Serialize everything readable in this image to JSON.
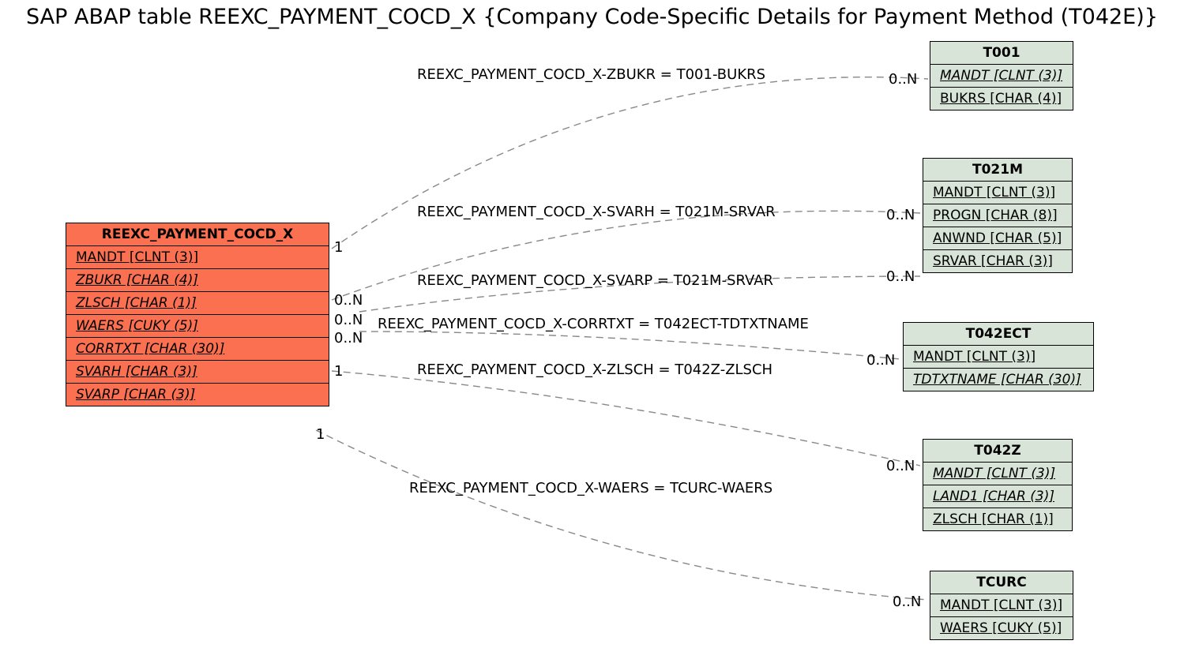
{
  "title": "SAP ABAP table REEXC_PAYMENT_COCD_X {Company Code-Specific Details for Payment Method (T042E)}",
  "main": {
    "name": "REEXC_PAYMENT_COCD_X",
    "fields": [
      "MANDT [CLNT (3)]",
      "ZBUKR [CHAR (4)]",
      "ZLSCH [CHAR (1)]",
      "WAERS [CUKY (5)]",
      "CORRTXT [CHAR (30)]",
      "SVARH [CHAR (3)]",
      "SVARP [CHAR (3)]"
    ],
    "italic": [
      false,
      true,
      true,
      true,
      true,
      true,
      true
    ]
  },
  "targets": {
    "t001": {
      "name": "T001",
      "fields": [
        "MANDT [CLNT (3)]",
        "BUKRS [CHAR (4)]"
      ],
      "italic": [
        true,
        false
      ]
    },
    "t021m": {
      "name": "T021M",
      "fields": [
        "MANDT [CLNT (3)]",
        "PROGN [CHAR (8)]",
        "ANWND [CHAR (5)]",
        "SRVAR [CHAR (3)]"
      ],
      "italic": [
        false,
        false,
        false,
        false
      ]
    },
    "t042ect": {
      "name": "T042ECT",
      "fields": [
        "MANDT [CLNT (3)]",
        "TDTXTNAME [CHAR (30)]"
      ],
      "italic": [
        false,
        true
      ]
    },
    "t042z": {
      "name": "T042Z",
      "fields": [
        "MANDT [CLNT (3)]",
        "LAND1 [CHAR (3)]",
        "ZLSCH [CHAR (1)]"
      ],
      "italic": [
        true,
        true,
        false
      ]
    },
    "tcurc": {
      "name": "TCURC",
      "fields": [
        "MANDT [CLNT (3)]",
        "WAERS [CUKY (5)]"
      ],
      "italic": [
        false,
        false
      ]
    }
  },
  "rels": {
    "r1": "REEXC_PAYMENT_COCD_X-ZBUKR = T001-BUKRS",
    "r2": "REEXC_PAYMENT_COCD_X-SVARH = T021M-SRVAR",
    "r3": "REEXC_PAYMENT_COCD_X-SVARP = T021M-SRVAR",
    "r4": "REEXC_PAYMENT_COCD_X-CORRTXT = T042ECT-TDTXTNAME",
    "r5": "REEXC_PAYMENT_COCD_X-ZLSCH = T042Z-ZLSCH",
    "r6": "REEXC_PAYMENT_COCD_X-WAERS = TCURC-WAERS"
  },
  "cards": {
    "l1": "1",
    "l2": "0..N",
    "l3": "0..N",
    "l4": "0..N",
    "l5": "1",
    "l6": "1",
    "rt1": "0..N",
    "rt2": "0..N",
    "rt3": "0..N",
    "rt4": "0..N",
    "rt5": "0..N",
    "rt6": "0..N"
  },
  "chart_data": {
    "type": "table",
    "description": "Entity-relationship diagram for SAP ABAP table REEXC_PAYMENT_COCD_X and related tables",
    "source_entity": {
      "name": "REEXC_PAYMENT_COCD_X",
      "color": "orange",
      "fields": [
        {
          "name": "MANDT",
          "type": "CLNT",
          "len": 3,
          "key_italic": false
        },
        {
          "name": "ZBUKR",
          "type": "CHAR",
          "len": 4,
          "key_italic": true
        },
        {
          "name": "ZLSCH",
          "type": "CHAR",
          "len": 1,
          "key_italic": true
        },
        {
          "name": "WAERS",
          "type": "CUKY",
          "len": 5,
          "key_italic": true
        },
        {
          "name": "CORRTXT",
          "type": "CHAR",
          "len": 30,
          "key_italic": true
        },
        {
          "name": "SVARH",
          "type": "CHAR",
          "len": 3,
          "key_italic": true
        },
        {
          "name": "SVARP",
          "type": "CHAR",
          "len": 3,
          "key_italic": true
        }
      ]
    },
    "target_entities": [
      {
        "name": "T001",
        "color": "green",
        "fields": [
          {
            "name": "MANDT",
            "type": "CLNT",
            "len": 3,
            "key_italic": true
          },
          {
            "name": "BUKRS",
            "type": "CHAR",
            "len": 4,
            "key_italic": false
          }
        ]
      },
      {
        "name": "T021M",
        "color": "green",
        "fields": [
          {
            "name": "MANDT",
            "type": "CLNT",
            "len": 3,
            "key_italic": false
          },
          {
            "name": "PROGN",
            "type": "CHAR",
            "len": 8,
            "key_italic": false
          },
          {
            "name": "ANWND",
            "type": "CHAR",
            "len": 5,
            "key_italic": false
          },
          {
            "name": "SRVAR",
            "type": "CHAR",
            "len": 3,
            "key_italic": false
          }
        ]
      },
      {
        "name": "T042ECT",
        "color": "green",
        "fields": [
          {
            "name": "MANDT",
            "type": "CLNT",
            "len": 3,
            "key_italic": false
          },
          {
            "name": "TDTXTNAME",
            "type": "CHAR",
            "len": 30,
            "key_italic": true
          }
        ]
      },
      {
        "name": "T042Z",
        "color": "green",
        "fields": [
          {
            "name": "MANDT",
            "type": "CLNT",
            "len": 3,
            "key_italic": true
          },
          {
            "name": "LAND1",
            "type": "CHAR",
            "len": 3,
            "key_italic": true
          },
          {
            "name": "ZLSCH",
            "type": "CHAR",
            "len": 1,
            "key_italic": false
          }
        ]
      },
      {
        "name": "TCURC",
        "color": "green",
        "fields": [
          {
            "name": "MANDT",
            "type": "CLNT",
            "len": 3,
            "key_italic": false
          },
          {
            "name": "WAERS",
            "type": "CUKY",
            "len": 5,
            "key_italic": false
          }
        ]
      }
    ],
    "relationships": [
      {
        "from": "REEXC_PAYMENT_COCD_X",
        "from_field": "ZBUKR",
        "to": "T001",
        "to_field": "BUKRS",
        "from_card": "1",
        "to_card": "0..N"
      },
      {
        "from": "REEXC_PAYMENT_COCD_X",
        "from_field": "SVARH",
        "to": "T021M",
        "to_field": "SRVAR",
        "from_card": "0..N",
        "to_card": "0..N"
      },
      {
        "from": "REEXC_PAYMENT_COCD_X",
        "from_field": "SVARP",
        "to": "T021M",
        "to_field": "SRVAR",
        "from_card": "0..N",
        "to_card": "0..N"
      },
      {
        "from": "REEXC_PAYMENT_COCD_X",
        "from_field": "CORRTXT",
        "to": "T042ECT",
        "to_field": "TDTXTNAME",
        "from_card": "0..N",
        "to_card": "0..N"
      },
      {
        "from": "REEXC_PAYMENT_COCD_X",
        "from_field": "ZLSCH",
        "to": "T042Z",
        "to_field": "ZLSCH",
        "from_card": "1",
        "to_card": "0..N"
      },
      {
        "from": "REEXC_PAYMENT_COCD_X",
        "from_field": "WAERS",
        "to": "TCURC",
        "to_field": "WAERS",
        "from_card": "1",
        "to_card": "0..N"
      }
    ]
  }
}
